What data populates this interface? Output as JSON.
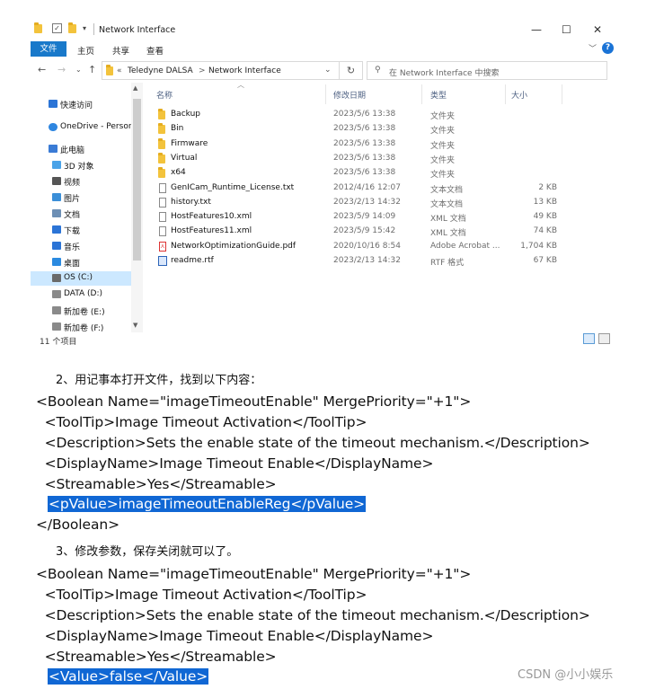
{
  "window": {
    "title": "Network Interface",
    "controls": {
      "minimize": "—",
      "maximize": "☐",
      "close": "✕"
    },
    "ribbon_tabs": [
      "文件",
      "主页",
      "共享",
      "查看"
    ],
    "address": {
      "overflow": "«",
      "crumbs": [
        "Teledyne DALSA",
        "Network Interface"
      ],
      "separator": ">"
    },
    "search_placeholder": "在 Network Interface 中搜索"
  },
  "nav": [
    {
      "label": "快速访问",
      "icon": "pin-icon",
      "color": "#2b74d6"
    },
    {
      "label": "OneDrive - Person",
      "icon": "cloud-icon",
      "color": "#2f86e0"
    },
    {
      "label": "此电脑",
      "icon": "computer-icon",
      "color": "#3a7bd5"
    },
    {
      "label": "3D 对象",
      "icon": "cube-icon",
      "color": "#4aa3e8"
    },
    {
      "label": "视频",
      "icon": "video-icon",
      "color": "#555555"
    },
    {
      "label": "图片",
      "icon": "picture-icon",
      "color": "#3b8fd8"
    },
    {
      "label": "文档",
      "icon": "document-icon",
      "color": "#6d8fb5"
    },
    {
      "label": "下载",
      "icon": "download-icon",
      "color": "#2b74d6"
    },
    {
      "label": "音乐",
      "icon": "music-icon",
      "color": "#2b74d6"
    },
    {
      "label": "桌面",
      "icon": "desktop-icon",
      "color": "#2b8ae0"
    },
    {
      "label": "OS (C:)",
      "icon": "drive-c-icon",
      "color": "#6a6a6a"
    },
    {
      "label": "DATA (D:)",
      "icon": "drive-icon",
      "color": "#8a8a8a"
    },
    {
      "label": "新加卷 (E:)",
      "icon": "drive-icon",
      "color": "#8a8a8a"
    },
    {
      "label": "新加卷 (F:)",
      "icon": "drive-icon",
      "color": "#8a8a8a"
    }
  ],
  "columns": [
    "名称",
    "修改日期",
    "类型",
    "大小"
  ],
  "files": [
    {
      "name": "Backup",
      "date": "2023/5/6 13:38",
      "type": "文件夹",
      "size": "",
      "icon": "folder"
    },
    {
      "name": "Bin",
      "date": "2023/5/6 13:38",
      "type": "文件夹",
      "size": "",
      "icon": "folder"
    },
    {
      "name": "Firmware",
      "date": "2023/5/6 13:38",
      "type": "文件夹",
      "size": "",
      "icon": "folder"
    },
    {
      "name": "Virtual",
      "date": "2023/5/6 13:38",
      "type": "文件夹",
      "size": "",
      "icon": "folder"
    },
    {
      "name": "x64",
      "date": "2023/5/6 13:38",
      "type": "文件夹",
      "size": "",
      "icon": "folder"
    },
    {
      "name": "GenICam_Runtime_License.txt",
      "date": "2012/4/16 12:07",
      "type": "文本文档",
      "size": "2 KB",
      "icon": "doc"
    },
    {
      "name": "history.txt",
      "date": "2023/2/13 14:32",
      "type": "文本文档",
      "size": "13 KB",
      "icon": "doc"
    },
    {
      "name": "HostFeatures10.xml",
      "date": "2023/5/9 14:09",
      "type": "XML 文档",
      "size": "49 KB",
      "icon": "doc"
    },
    {
      "name": "HostFeatures11.xml",
      "date": "2023/5/9 15:42",
      "type": "XML 文档",
      "size": "74 KB",
      "icon": "doc"
    },
    {
      "name": "NetworkOptimizationGuide.pdf",
      "date": "2020/10/16 8:54",
      "type": "Adobe Acrobat ...",
      "size": "1,704 KB",
      "icon": "pdf"
    },
    {
      "name": "readme.rtf",
      "date": "2023/2/13 14:32",
      "type": "RTF 格式",
      "size": "67 KB",
      "icon": "rtf"
    }
  ],
  "status": "11 个项目",
  "step2": "2、用记事本打开文件，找到以下内容：",
  "code1": [
    "<Boolean Name=\"imageTimeoutEnable\" MergePriority=\"+1\">",
    "  <ToolTip>Image Timeout Activation</ToolTip>",
    "  <Description>Sets the enable state of the timeout mechanism.</Description>",
    "  <DisplayName>Image Timeout Enable</DisplayName>",
    "  <Streamable>Yes</Streamable>",
    "<pValue>imageTimeoutEnableReg</pValue>",
    "</Boolean>"
  ],
  "step3": "3、修改参数，保存关闭就可以了。",
  "code2": [
    "<Boolean Name=\"imageTimeoutEnable\" MergePriority=\"+1\">",
    "  <ToolTip>Image Timeout Activation</ToolTip>",
    "  <Description>Sets the enable state of the timeout mechanism.</Description>",
    "  <DisplayName>Image Timeout Enable</DisplayName>",
    "  <Streamable>Yes</Streamable>",
    "<Value>false</Value>"
  ],
  "watermark": "CSDN @小小娱乐"
}
